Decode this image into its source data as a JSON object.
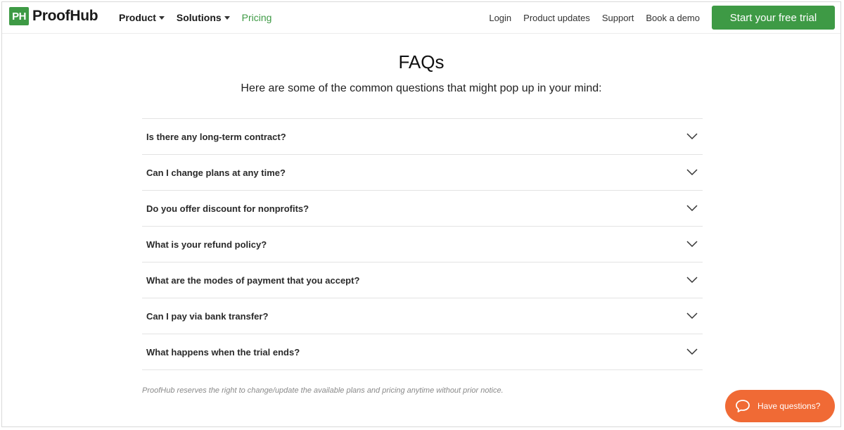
{
  "header": {
    "logo_badge": "PH",
    "logo_text": "ProofHub",
    "nav_left": [
      {
        "label": "Product",
        "dropdown": true
      },
      {
        "label": "Solutions",
        "dropdown": true
      },
      {
        "label": "Pricing",
        "dropdown": false,
        "active": true
      }
    ],
    "nav_right": [
      "Login",
      "Product updates",
      "Support",
      "Book a demo"
    ],
    "cta_label": "Start your free trial"
  },
  "main": {
    "title": "FAQs",
    "subtitle": "Here are some of the common questions that might pop up in your mind:",
    "faqs": [
      {
        "question": "Is there any long-term contract?",
        "icon": "chevron-down-icon"
      },
      {
        "question": "Can I change plans at any time?",
        "icon": "chevron-down-icon"
      },
      {
        "question": "Do you offer discount for nonprofits?",
        "icon": "chevron-down-icon"
      },
      {
        "question": "What is your refund policy?",
        "icon": "chevron-down-icon"
      },
      {
        "question": "What are the modes of payment that you accept?",
        "icon": "chevron-down-icon"
      },
      {
        "question": "Can I pay via bank transfer?",
        "icon": "chevron-down-icon"
      },
      {
        "question": "What happens when the trial ends?",
        "icon": "chevron-down-icon"
      }
    ],
    "note": "ProofHub reserves the right to change/update the available plans and pricing anytime without prior notice."
  },
  "help_widget": {
    "label": "Have questions?",
    "icon": "chat-bubble-icon"
  },
  "colors": {
    "brand_green": "#3e9a45",
    "help_orange": "#f06a35"
  }
}
